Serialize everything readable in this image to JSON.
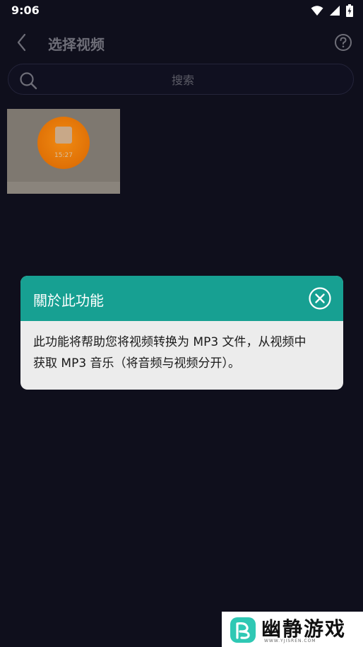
{
  "status_bar": {
    "time": "9:06",
    "icons": [
      "wifi-icon",
      "signal-icon",
      "battery-icon"
    ]
  },
  "header": {
    "title": "选择视频",
    "back_icon": "chevron-left-icon",
    "help_icon": "help-circle-icon"
  },
  "search": {
    "placeholder": "搜索",
    "value": ""
  },
  "videos": [
    {
      "duration": "15:27"
    }
  ],
  "dialog": {
    "title": "關於此功能",
    "body_line1": "此功能将帮助您将视频转换为 MP3 文件，从视频中",
    "body_line2": "获取 MP3 音乐（将音频与视频分开）。",
    "header_color": "#17a092"
  },
  "watermark": {
    "name": "幽静游戏",
    "url": "WWW.YJISREN.COM"
  },
  "colors": {
    "background": "#0f0f1c",
    "accent": "#17a092",
    "thumb_orange": "#e07106"
  }
}
